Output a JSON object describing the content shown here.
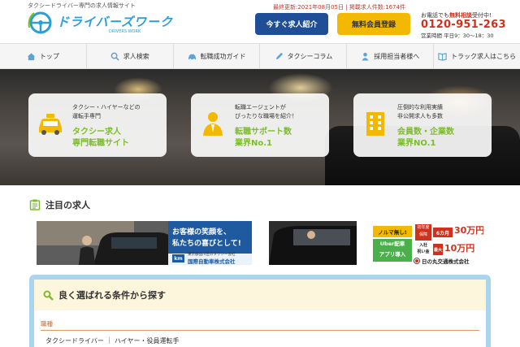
{
  "header": {
    "tagline": "タクシードライバー専門の求人情報サイト",
    "logo_name": "ドライバーズワーク",
    "logo_sub": "DRIVERS WORK",
    "update_info": "最終更新:2021年08月05日 | 掲載求人件数:1674件",
    "intro_button": "今すぐ求人紹介",
    "register_button": "無料会員登録",
    "contact_prefix": "お電話でも",
    "contact_highlight": "無料相談",
    "contact_suffix": "受付中!",
    "phone": "0120-951-263",
    "hours": "営業時間 平日9：30～18：30"
  },
  "nav": {
    "items": [
      {
        "label": "トップ",
        "icon": "home-icon"
      },
      {
        "label": "求人検索",
        "icon": "search-icon"
      },
      {
        "label": "転職成功ガイド",
        "icon": "car-icon"
      },
      {
        "label": "タクシーコラム",
        "icon": "pen-icon"
      },
      {
        "label": "採用担当者様へ",
        "icon": "person-icon"
      },
      {
        "label": "トラック求人はこちら",
        "icon": "book-icon"
      }
    ]
  },
  "hero": {
    "cards": [
      {
        "line1": "タクシー・ハイヤーなどの",
        "line2": "運転手専門",
        "big1": "タクシー求人",
        "big2": "専門転職サイト",
        "icon": "taxi-icon"
      },
      {
        "line1": "転職エージェントが",
        "line2": "ぴったりな職場を紹介！",
        "big1": "転職サポート数",
        "big2": "業界No.1",
        "icon": "agent-icon"
      },
      {
        "line1": "圧倒的な利用実績",
        "line2": "非公開求人も多数",
        "big1": "会員数・企業数",
        "big2": "業界NO.1",
        "icon": "building-icon"
      }
    ]
  },
  "featured": {
    "title": "注目の求人",
    "banner1": {
      "headline1": "お客様の笑顔を、",
      "headline2": "私たちの喜びとして!",
      "company_caption": "東京都品川区のタクシー会社",
      "company": "国際自動車株式会社"
    },
    "banner2": {
      "badge1": "ノルマ無し!",
      "badge2": "Uber配車",
      "badge3": "アプリ導入",
      "label1a": "初年度",
      "label1b": "保障",
      "months": "6カ月",
      "amount1": "30万円",
      "label2a": "入社",
      "label2b": "祝い金",
      "label2c": "最大",
      "amount2": "10万円",
      "company": "日の丸交通株式会社"
    }
  },
  "search": {
    "title": "良く選ばれる条件から探す",
    "section": "職種",
    "items": "タクシードライバー ｜ ハイヤー・役員運転手"
  },
  "colors": {
    "brand_blue": "#2a9fd6",
    "intro_button": "#1f4e96",
    "register_button": "#f3b800",
    "phone_red": "#d0311c",
    "hero_green": "#7cbd2b",
    "search_border": "#a9d6ee"
  }
}
